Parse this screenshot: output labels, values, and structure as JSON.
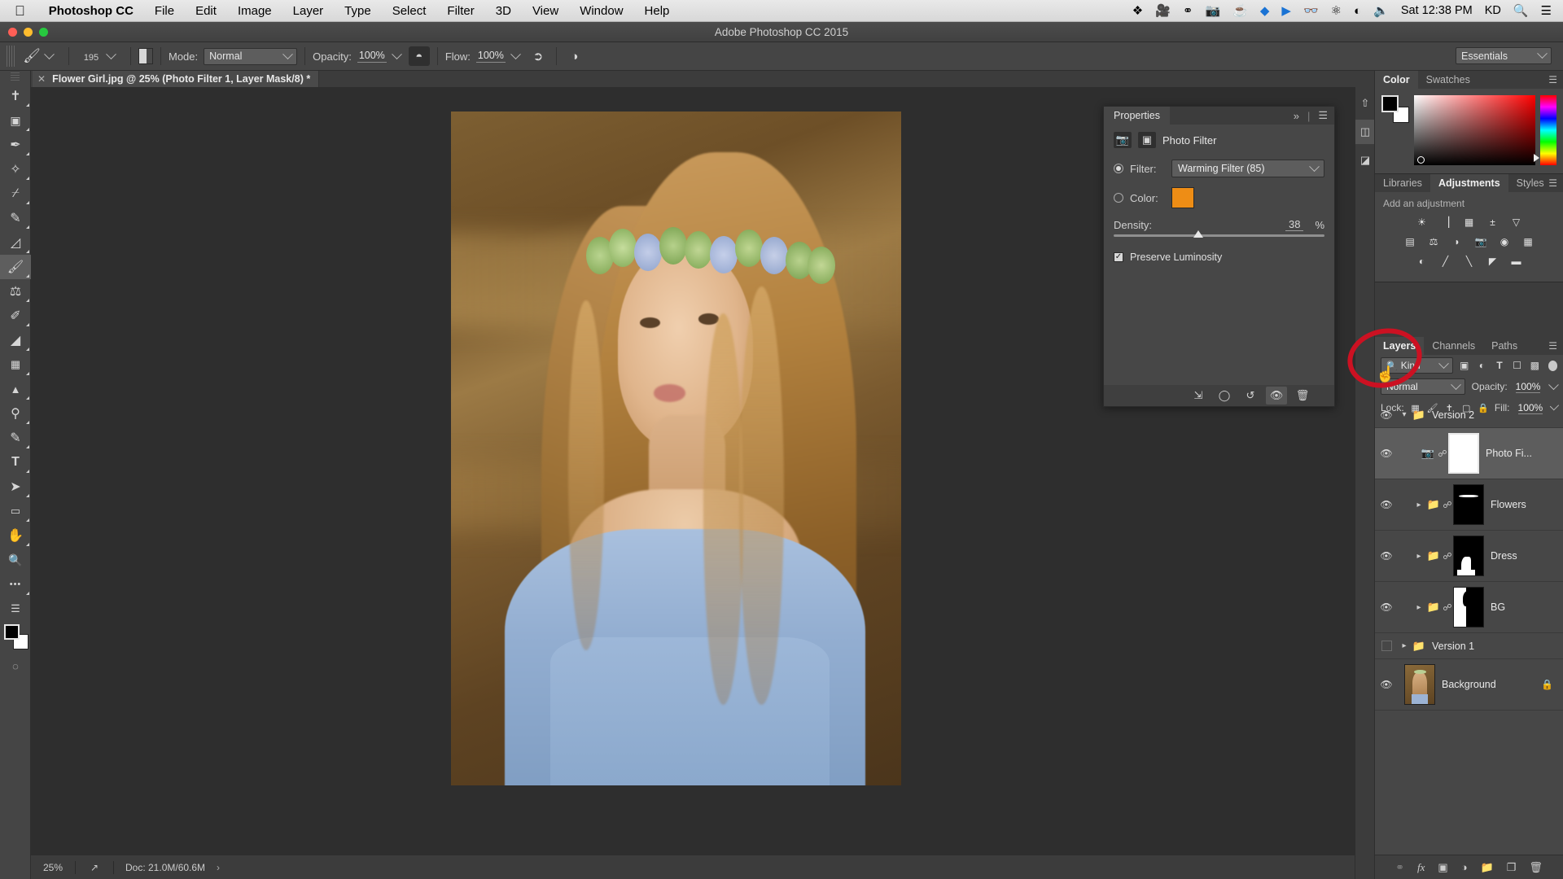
{
  "macos_menu": {
    "apple_icon": "apple-icon",
    "app_name": "Photoshop CC",
    "items": [
      "File",
      "Edit",
      "Image",
      "Layer",
      "Type",
      "Select",
      "Filter",
      "3D",
      "View",
      "Window",
      "Help"
    ],
    "status_icons": [
      "dropbox-icon",
      "screen-record-icon",
      "creative-cloud-icon",
      "camera-icon",
      "coffee-icon",
      "diamond-icon",
      "play-icon",
      "binoculars-icon",
      "bluetooth-icon",
      "wifi-icon",
      "volume-icon"
    ],
    "clock": "Sat 12:38 PM",
    "user": "KD",
    "search_icon": "search-icon",
    "notification_icon": "list-icon"
  },
  "window": {
    "title": "Adobe Photoshop CC 2015"
  },
  "options_bar": {
    "tool_icon": "brush-icon",
    "brush_size": "195",
    "brush_panel_icon": "brush-panel-icon",
    "mode_label": "Mode:",
    "mode_value": "Normal",
    "opacity_label": "Opacity:",
    "opacity_value": "100%",
    "pressure_opacity_icon": "pressure-opacity-icon",
    "flow_label": "Flow:",
    "flow_value": "100%",
    "airbrush_icon": "airbrush-icon",
    "smoothing_icon": "smoothing-icon",
    "workspace": "Essentials"
  },
  "document_tab": {
    "close_icon": "close-icon",
    "title": "Flower Girl.jpg @ 25% (Photo Filter 1, Layer Mask/8) *"
  },
  "toolbox": {
    "tools": [
      {
        "name": "move-tool",
        "glyph": "✥"
      },
      {
        "name": "marquee-tool",
        "glyph": "▭"
      },
      {
        "name": "lasso-tool",
        "glyph": "✒"
      },
      {
        "name": "quick-selection-tool",
        "glyph": "✧"
      },
      {
        "name": "crop-tool",
        "glyph": "⌗"
      },
      {
        "name": "eyedropper-tool",
        "glyph": "✑"
      },
      {
        "name": "healing-brush-tool",
        "glyph": "✚"
      },
      {
        "name": "brush-tool",
        "glyph": "🖌",
        "active": true
      },
      {
        "name": "clone-stamp-tool",
        "glyph": "⌷"
      },
      {
        "name": "history-brush-tool",
        "glyph": "✎"
      },
      {
        "name": "eraser-tool",
        "glyph": "◣"
      },
      {
        "name": "gradient-tool",
        "glyph": "▤"
      },
      {
        "name": "blur-tool",
        "glyph": "▲"
      },
      {
        "name": "dodge-tool",
        "glyph": "◯"
      },
      {
        "name": "pen-tool",
        "glyph": "✐"
      },
      {
        "name": "type-tool",
        "glyph": "T"
      },
      {
        "name": "path-selection-tool",
        "glyph": "➤"
      },
      {
        "name": "rectangle-tool",
        "glyph": "▬"
      },
      {
        "name": "hand-tool",
        "glyph": "✋"
      },
      {
        "name": "zoom-tool",
        "glyph": "🔍"
      },
      {
        "name": "edit-toolbar-tool",
        "glyph": "•••"
      }
    ],
    "screen_mode_icon": "screen-mode-icon",
    "quick_mask_icon": "quick-mask-icon",
    "foreground_color": "#000000",
    "background_color": "#ffffff"
  },
  "properties_panel": {
    "tab": "Properties",
    "collapse_icon": "collapse-icon",
    "menu_icon": "panel-menu-icon",
    "adjustment_icon": "photo-filter-icon",
    "mask_icon": "layer-mask-icon",
    "heading": "Photo Filter",
    "filter_label": "Filter:",
    "filter_value": "Warming Filter (85)",
    "color_label": "Color:",
    "color_value": "#ee8d15",
    "density_label": "Density:",
    "density_value": "38",
    "density_unit": "%",
    "density_percent": 38,
    "preserve_luminosity_label": "Preserve Luminosity",
    "preserve_luminosity_checked": true,
    "footer_icons": [
      "clip-to-layer-icon",
      "toggle-previous-state-icon",
      "reset-icon",
      "visibility-icon",
      "delete-icon"
    ]
  },
  "dock_rail": [
    {
      "name": "history-icon",
      "glyph": "⑃"
    },
    {
      "name": "3d-icon",
      "glyph": "◱",
      "active": true
    },
    {
      "name": "properties-rail-icon",
      "glyph": "◨"
    }
  ],
  "color_panel": {
    "tabs": [
      "Color",
      "Swatches"
    ],
    "selected_tab": "Color",
    "menu_icon": "panel-menu-icon",
    "foreground_color": "#000000",
    "background_color": "#ffffff"
  },
  "adjustments_panel": {
    "tabs": [
      "Libraries",
      "Adjustments",
      "Styles"
    ],
    "selected_tab": "Adjustments",
    "menu_icon": "panel-menu-icon",
    "hint": "Add an adjustment",
    "icons": [
      [
        "brightness-contrast-icon",
        "levels-icon",
        "curves-icon",
        "exposure-icon",
        "vibrance-icon"
      ],
      [
        "hue-saturation-icon",
        "color-balance-icon",
        "black-white-icon",
        "photo-filter-icon",
        "channel-mixer-icon",
        "color-lookup-icon"
      ],
      [
        "invert-icon",
        "posterize-icon",
        "threshold-icon",
        "gradient-map-icon",
        "selective-color-icon"
      ]
    ],
    "glyphs": [
      [
        "☀",
        "▥",
        "▩",
        "±",
        "▽"
      ],
      [
        "▤",
        "⚖",
        "◧",
        "◉",
        "◍",
        "▦"
      ],
      [
        "◪",
        "◩",
        "◲",
        "◤",
        "▬"
      ]
    ]
  },
  "layers_panel": {
    "tabs": [
      "Layers",
      "Channels",
      "Paths"
    ],
    "selected_tab": "Layers",
    "menu_icon": "panel-menu-icon",
    "kind_label": "Kind",
    "filter_icons": [
      "filter-pixel-icon",
      "filter-adjustment-icon",
      "filter-type-icon",
      "filter-shape-icon",
      "filter-smart-icon"
    ],
    "blend_mode": "Normal",
    "opacity_label": "Opacity:",
    "opacity_value": "100%",
    "lock_label": "Lock:",
    "lock_icons": [
      "lock-transparent-icon",
      "lock-image-icon",
      "lock-position-icon",
      "lock-artboard-icon",
      "lock-all-icon"
    ],
    "fill_label": "Fill:",
    "fill_value": "100%",
    "layers": [
      {
        "name": "Version 2",
        "type": "group",
        "visible": true,
        "expanded": true,
        "selected": false
      },
      {
        "name": "Photo Fi...",
        "type": "adjustment",
        "visible": true,
        "selected": true,
        "indent": true,
        "thumb": "white",
        "linked": true
      },
      {
        "name": "Flowers",
        "type": "group",
        "visible": true,
        "expanded": false,
        "selected": false,
        "indent": true,
        "thumb": "mask-flowers",
        "linked": true
      },
      {
        "name": "Dress",
        "type": "group",
        "visible": true,
        "expanded": false,
        "selected": false,
        "indent": true,
        "thumb": "mask-dress",
        "linked": true
      },
      {
        "name": "BG",
        "type": "group",
        "visible": true,
        "expanded": false,
        "selected": false,
        "indent": true,
        "thumb": "mask-bg",
        "linked": true
      },
      {
        "name": "Version 1",
        "type": "group",
        "visible": false,
        "expanded": false,
        "selected": false
      },
      {
        "name": "Background",
        "type": "image",
        "visible": true,
        "selected": false,
        "thumb": "photo",
        "locked": true
      }
    ],
    "footer_icons": [
      "link-layers-icon",
      "layer-style-fx-icon",
      "add-mask-icon",
      "new-adjustment-icon",
      "new-group-icon",
      "new-layer-icon",
      "delete-layer-icon"
    ],
    "footer_glyphs": [
      "⚭",
      "fx",
      "▣",
      "◑",
      "▭",
      "❏",
      "🗑"
    ]
  },
  "status_bar": {
    "zoom": "25%",
    "share_icon": "share-icon",
    "doc_info": "Doc: 21.0M/60.6M",
    "expand_icon": "chevron-right-icon"
  },
  "annotation": {
    "shape": "red-ellipse-highlight",
    "color": "#cc1122",
    "target": "group-visibility-toggle",
    "cursor_icon": "hand-cursor-icon"
  },
  "canvas": {
    "image_alt": "Flower Girl portrait photo",
    "zoom_percent": 25
  }
}
